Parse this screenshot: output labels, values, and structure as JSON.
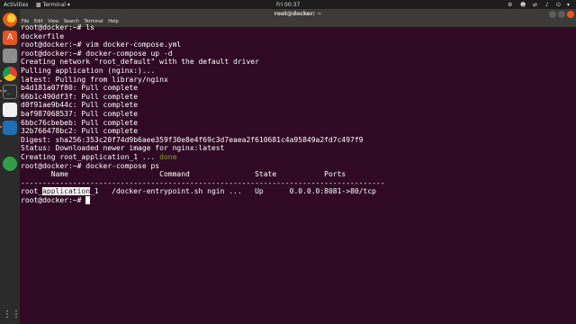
{
  "topbar": {
    "activities": "Activities",
    "app_name": "Terminal",
    "clock": "Fri 00:37"
  },
  "window": {
    "title": "root@docker: ~",
    "menus": [
      "File",
      "Edit",
      "View",
      "Search",
      "Terminal",
      "Help"
    ]
  },
  "terminal": {
    "lines": [
      "root@docker:~# ls",
      "dockerfile",
      "root@docker:~# vim docker-compose.yml",
      "root@docker:~# docker-compose up -d",
      "Creating network \"root_default\" with the default driver",
      "Pulling application (nginx:)...",
      "latest: Pulling from library/nginx",
      "b4d181a07f80: Pull complete",
      "66b1c490df3f: Pull complete",
      "d0f91ae9b44c: Pull complete",
      "baf987068537: Pull complete",
      "6bbc76cbebeb: Pull complete",
      "32b766478bc2: Pull complete",
      "Digest: sha256:353c20f74d9b6aee359f30e8e4f69c3d7eaea2f610681c4a95849a2fd7c497f9",
      "Status: Downloaded newer image for nginx:latest"
    ],
    "creating_prefix": "Creating root_application_1 ... ",
    "creating_done": "done",
    "ps_command": "root@docker:~# docker-compose ps",
    "ps_header": "       Name                     Command               State           Ports",
    "ps_divider": "------------------------------------------------------------------------------------",
    "ps_row_prefix": "root_",
    "ps_row_highlight": "application",
    "ps_row_suffix": "_1   /docker-entrypoint.sh ngin ...   Up      0.0.0.0:8081->80/tcp",
    "final_prompt": "root@docker:~# "
  },
  "colors": {
    "terminal_bg": "#300a24",
    "topbar_bg": "#1d1d1d",
    "dock_bg": "#2b2b2b",
    "menubar_bg": "#3c3b37",
    "done_text": "#8a9a2a",
    "close_button": "#e95420"
  },
  "dock_icons": [
    "firefox-icon",
    "software-center-icon",
    "files-icon",
    "chrome-icon",
    "terminal-icon",
    "text-editor-icon",
    "vscode-icon",
    "update-icon",
    "app-grid-icon"
  ]
}
